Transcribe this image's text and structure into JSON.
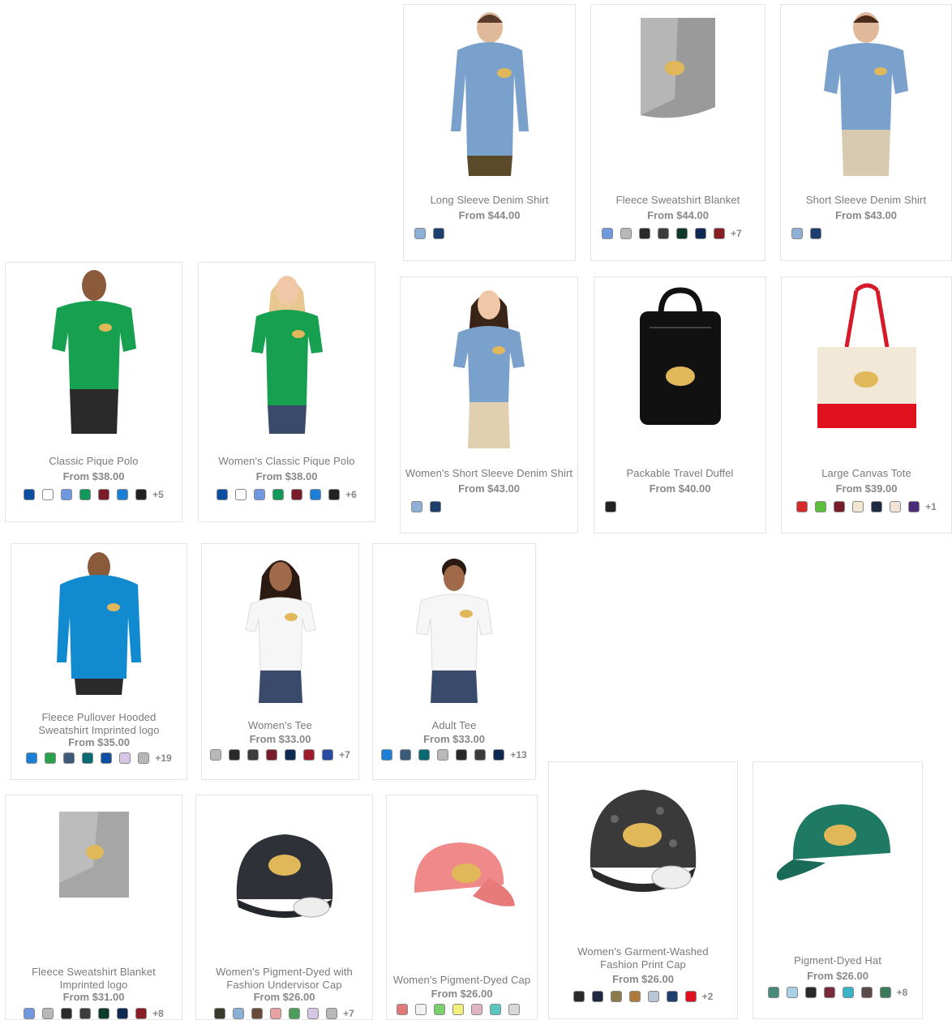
{
  "price_prefix": "From",
  "products": [
    {
      "name": "Long Sleeve Denim Shirt",
      "price": "From $44.00",
      "image": "man-long-sleeve-denim-shirt",
      "swatches": [
        "#8fb0d6",
        "#1e3e6e"
      ],
      "more": ""
    },
    {
      "name": "Fleece Sweatshirt Blanket",
      "price": "From $44.00",
      "image": "grey-fleece-blanket",
      "swatches": [
        "#6f98e0",
        "#b8b8b8",
        "#2a2a2a",
        "#3c3c3c",
        "#0e3a2a",
        "#0f2a52",
        "#8a1c24"
      ],
      "more": "+7"
    },
    {
      "name": "Short Sleeve Denim Shirt",
      "price": "From $43.00",
      "image": "man-short-sleeve-denim-shirt",
      "swatches": [
        "#8fb0d6",
        "#1e3e6e"
      ],
      "more": ""
    },
    {
      "name": "Classic Pique Polo",
      "price": "From $38.00",
      "image": "man-green-polo",
      "swatches": [
        "#0b4ea2",
        "#ffffff",
        "#6f98e0",
        "#0f9a5a",
        "#7a1c2a",
        "#1a7fd6",
        "#222222"
      ],
      "more": "+5"
    },
    {
      "name": "Women's Classic Pique Polo",
      "price": "From $38.00",
      "image": "woman-green-polo",
      "swatches": [
        "#0b4ea2",
        "#ffffff",
        "#6f98e0",
        "#0f9a5a",
        "#7a1c2a",
        "#1a7fd6",
        "#222222"
      ],
      "more": "+6"
    },
    {
      "name": "Women's Short Sleeve Denim Shirt",
      "price": "From $43.00",
      "image": "woman-denim-shirt",
      "swatches": [
        "#8fb0d6",
        "#1e3e6e"
      ],
      "more": ""
    },
    {
      "name": "Packable Travel Duffel",
      "price": "From $40.00",
      "image": "black-travel-duffel",
      "swatches": [
        "#222222"
      ],
      "more": ""
    },
    {
      "name": "Large Canvas Tote",
      "price": "From $39.00",
      "image": "canvas-tote-red",
      "swatches": [
        "#d92a2a",
        "#5cbf3c",
        "#7a1c2a",
        "#f1e6d0",
        "#1e2a44",
        "#f2e2da",
        "#4b2a7a"
      ],
      "more": "+1"
    },
    {
      "name": "Fleece Pullover Hooded Sweatshirt Imprinted logo",
      "price": "From $35.00",
      "image": "man-blue-hoodie",
      "swatches": [
        "#1a7fd6",
        "#2aa24a",
        "#3c5a7a",
        "#0a6a74",
        "#0b4ea2",
        "#d8c6e6",
        "#b8b8b8"
      ],
      "more": "+19"
    },
    {
      "name": "Women's Tee",
      "price": "From $33.00",
      "image": "woman-white-tee",
      "swatches": [
        "#b8b8b8",
        "#2a2a2a",
        "#3c3c3c",
        "#7a1c2a",
        "#0f2a52",
        "#a01c2a",
        "#2a4aa2"
      ],
      "more": "+7"
    },
    {
      "name": "Adult Tee",
      "price": "From $33.00",
      "image": "person-white-tee",
      "swatches": [
        "#1a7fd6",
        "#3c5a7a",
        "#0a6a74",
        "#b8b8b8",
        "#2a2a2a",
        "#3c3c3c",
        "#0f2a52"
      ],
      "more": "+13"
    },
    {
      "name": "Women's Garment-Washed Fashion Print Cap",
      "price": "From $26.00",
      "image": "leopard-print-cap",
      "swatches": [
        "#2a2a2a",
        "#1e2a44",
        "#8a7a4a",
        "#b07a3a",
        "#b8c6d6",
        "#1e3e6e",
        "#e0101e"
      ],
      "more": "+2"
    },
    {
      "name": "Pigment-Dyed Hat",
      "price": "From $26.00",
      "image": "green-dyed-hat",
      "swatches": [
        "#4a8a7a",
        "#a8d0e8",
        "#2a2a2a",
        "#7a2a3a",
        "#3ab4c6",
        "#5a4a4a",
        "#3a7a5a"
      ],
      "more": "+8"
    },
    {
      "name": "Fleece Sweatshirt Blanket Imprinted logo",
      "price": "From $31.00",
      "image": "grey-folded-blanket",
      "swatches": [
        "#6f98e0",
        "#b8b8b8",
        "#2a2a2a",
        "#3c3c3c",
        "#0e3a2a",
        "#0f2a52",
        "#8a1c24"
      ],
      "more": "+8"
    },
    {
      "name": "Women's Pigment-Dyed with Fashion Undervisor Cap",
      "price": "From $26.00",
      "image": "black-fashion-cap",
      "swatches": [
        "#3a3a2a",
        "#8ab0d6",
        "#6a4a3a",
        "#e8a0a0",
        "#4aa05a",
        "#d8c6e6",
        "#b8b8b8"
      ],
      "more": "+7"
    },
    {
      "name": "Women's Pigment-Dyed Cap",
      "price": "From $26.00",
      "image": "pink-dyed-cap",
      "swatches": [
        "#e07a7a",
        "#f2f2f2",
        "#7ad06a",
        "#f0f07a",
        "#e0b4c0",
        "#5ac6c0",
        "#d8d8d8"
      ],
      "more": ""
    }
  ]
}
